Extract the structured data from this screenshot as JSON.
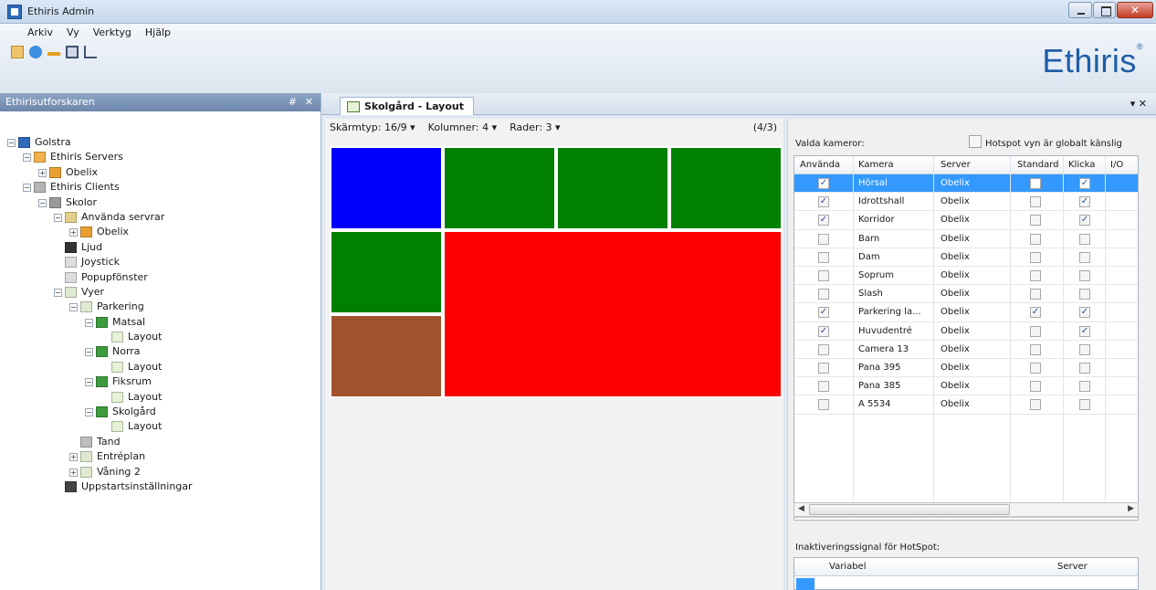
{
  "window": {
    "title": "Ethiris Admin"
  },
  "menu": [
    "Arkiv",
    "Vy",
    "Verktyg",
    "Hjälp"
  ],
  "brand": {
    "name": "Ethiris",
    "mark": "®",
    "color": "#1f5ea7"
  },
  "left_panel": {
    "title": "Ethirisutforskaren",
    "pin": "# ✕",
    "tree": [
      {
        "label": "Golstra",
        "level": 0,
        "icon": "root-icon",
        "expander": "−",
        "color": "#2f6ab8"
      },
      {
        "label": "Ethiris Servers",
        "level": 1,
        "icon": "servers-icon",
        "expander": "−",
        "color": "#f0b24a"
      },
      {
        "label": "Obelix",
        "level": 2,
        "icon": "server-icon",
        "expander": "+",
        "color": "#e8a030"
      },
      {
        "label": "Ethiris Clients",
        "level": 1,
        "icon": "clients-icon",
        "expander": "−",
        "color": "#b5b5b5"
      },
      {
        "label": "Skolor",
        "level": 2,
        "icon": "client-icon",
        "expander": "−",
        "color": "#9a9a9a"
      },
      {
        "label": "Använda servrar",
        "level": 3,
        "icon": "folder-icon",
        "expander": "−",
        "color": "#e3d08a"
      },
      {
        "label": "Obelix",
        "level": 4,
        "icon": "server-icon",
        "expander": "+",
        "color": "#e8a030"
      },
      {
        "label": "Ljud",
        "level": 3,
        "icon": "audio-icon",
        "expander": "",
        "color": "#333333"
      },
      {
        "label": "Joystick",
        "level": 3,
        "icon": "joystick-icon",
        "expander": "",
        "color": "#dddddd"
      },
      {
        "label": "Popupfönster",
        "level": 3,
        "icon": "popup-icon",
        "expander": "",
        "color": "#dddddd"
      },
      {
        "label": "Vyer",
        "level": 3,
        "icon": "views-icon",
        "expander": "−",
        "color": "#dfe9cf"
      },
      {
        "label": "Parkering",
        "level": 4,
        "icon": "view-folder-icon",
        "expander": "−",
        "color": "#dfe9cf"
      },
      {
        "label": "Matsal",
        "level": 5,
        "icon": "camera-view-icon",
        "expander": "−",
        "color": "#3c9b3c"
      },
      {
        "label": "Layout",
        "level": 6,
        "icon": "layout-icon",
        "expander": "",
        "color": "#e6f2d6"
      },
      {
        "label": "Norra",
        "level": 5,
        "icon": "camera-view-icon",
        "expander": "−",
        "color": "#3c9b3c"
      },
      {
        "label": "Layout",
        "level": 6,
        "icon": "layout-icon",
        "expander": "",
        "color": "#e6f2d6"
      },
      {
        "label": "Fiksrum",
        "level": 5,
        "icon": "camera-view-icon",
        "expander": "−",
        "color": "#3c9b3c"
      },
      {
        "label": "Layout",
        "level": 6,
        "icon": "layout-icon",
        "expander": "",
        "color": "#e6f2d6"
      },
      {
        "label": "Skolgård",
        "level": 5,
        "icon": "camera-view-icon",
        "expander": "−",
        "color": "#3c9b3c"
      },
      {
        "label": "Layout",
        "level": 6,
        "icon": "layout-icon",
        "expander": "",
        "color": "#e6f2d6"
      },
      {
        "label": "Tand",
        "level": 4,
        "icon": "grid-view-icon",
        "expander": "",
        "color": "#bdbdbd"
      },
      {
        "label": "Entréplan",
        "level": 4,
        "icon": "view-folder-icon",
        "expander": "+",
        "color": "#dfe9cf"
      },
      {
        "label": "Våning 2",
        "level": 4,
        "icon": "view-folder-icon",
        "expander": "+",
        "color": "#dfe9cf"
      },
      {
        "label": "Uppstartsinställningar",
        "level": 3,
        "icon": "startup-icon",
        "expander": "",
        "color": "#444444"
      }
    ]
  },
  "tab": {
    "label": "Skolgård - Layout",
    "controls": "▾ ✕"
  },
  "layout_bar": {
    "screen_type": "Skärmtyp: 16/9 ▾",
    "columns": "Kolumner: 4 ▾",
    "rows": "Rader: 3 ▾",
    "ratio": "(4/3)"
  },
  "layout_cells": [
    {
      "name": "cell-blue",
      "color": "#0000ff"
    },
    {
      "name": "cell-green-1",
      "color": "#008000"
    },
    {
      "name": "cell-green-2",
      "color": "#008000"
    },
    {
      "name": "cell-green-3",
      "color": "#008000"
    },
    {
      "name": "cell-green-4",
      "color": "#008000"
    },
    {
      "name": "cell-red-large",
      "color": "#ff0000"
    },
    {
      "name": "cell-brown",
      "color": "#a0522d"
    }
  ],
  "cameras": {
    "label": "Valda kameror:",
    "hotspot_label": "Hotspot vyn är globalt känslig",
    "columns": [
      "Använda",
      "Kamera",
      "Server",
      "Standard",
      "Klicka",
      "I/O"
    ],
    "rows": [
      {
        "use": true,
        "camera": "Hörsal",
        "server": "Obelix",
        "standard": false,
        "click": true,
        "selected": true
      },
      {
        "use": true,
        "camera": "Idrottshall",
        "server": "Obelix",
        "standard": false,
        "click": true,
        "selected": false
      },
      {
        "use": true,
        "camera": "Korridor",
        "server": "Obelix",
        "standard": false,
        "click": true,
        "selected": false
      },
      {
        "use": false,
        "camera": "Barn",
        "server": "Obelix",
        "standard": false,
        "click": false,
        "selected": false
      },
      {
        "use": false,
        "camera": "Dam",
        "server": "Obelix",
        "standard": false,
        "click": false,
        "selected": false
      },
      {
        "use": false,
        "camera": "Soprum",
        "server": "Obelix",
        "standard": false,
        "click": false,
        "selected": false
      },
      {
        "use": false,
        "camera": "Slash",
        "server": "Obelix",
        "standard": false,
        "click": false,
        "selected": false
      },
      {
        "use": true,
        "camera": "Parkering la...",
        "server": "Obelix",
        "standard": true,
        "click": true,
        "selected": false
      },
      {
        "use": true,
        "camera": "Huvudentré",
        "server": "Obelix",
        "standard": false,
        "click": true,
        "selected": false
      },
      {
        "use": false,
        "camera": "Camera 13",
        "server": "Obelix",
        "standard": false,
        "click": false,
        "selected": false
      },
      {
        "use": false,
        "camera": "Pana 395",
        "server": "Obelix",
        "standard": false,
        "click": false,
        "selected": false
      },
      {
        "use": false,
        "camera": "Pana 385",
        "server": "Obelix",
        "standard": false,
        "click": false,
        "selected": false
      },
      {
        "use": false,
        "camera": "A 5534",
        "server": "Obelix",
        "standard": false,
        "click": false,
        "selected": false
      }
    ],
    "scroll_thumb_glyph": "≡"
  },
  "hotspot_signal": {
    "label": "Inaktiveringssignal för HotSpot:",
    "columns": [
      "Variabel",
      "Server"
    ]
  },
  "colors": {
    "selection": "#3399ff",
    "accent": "#2f6ab8"
  }
}
